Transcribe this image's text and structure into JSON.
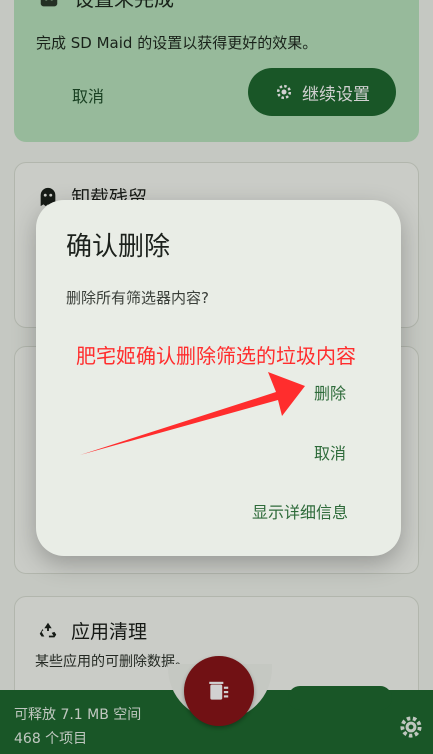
{
  "setup_card": {
    "title": "设置未完成",
    "description": "完成 SD Maid 的设置以获得更好的效果。",
    "cancel_label": "取消",
    "continue_label": "继续设置"
  },
  "leftover_card": {
    "title": "卸载残留"
  },
  "app_cleaner_card": {
    "title": "应用清理",
    "description": "某些应用的可删除数据。"
  },
  "bottom_bar": {
    "freeable": "可释放 7.1 MB 空间",
    "item_count": "468 个项目"
  },
  "dialog": {
    "title": "确认删除",
    "message": "删除所有筛选器内容?",
    "delete_label": "删除",
    "cancel_label": "取消",
    "details_label": "显示详细信息"
  },
  "annotation": {
    "text": "肥宅姬确认删除筛选的垃圾内容",
    "color": "#ff2d2d"
  },
  "colors": {
    "primary": "#1f6a30",
    "fab": "#8a1519",
    "setup_card_bg": "#b9e3bd"
  },
  "icons": [
    "android-robot-icon",
    "gear-icon",
    "ghost-icon",
    "recycle-icon",
    "trash-icon"
  ]
}
